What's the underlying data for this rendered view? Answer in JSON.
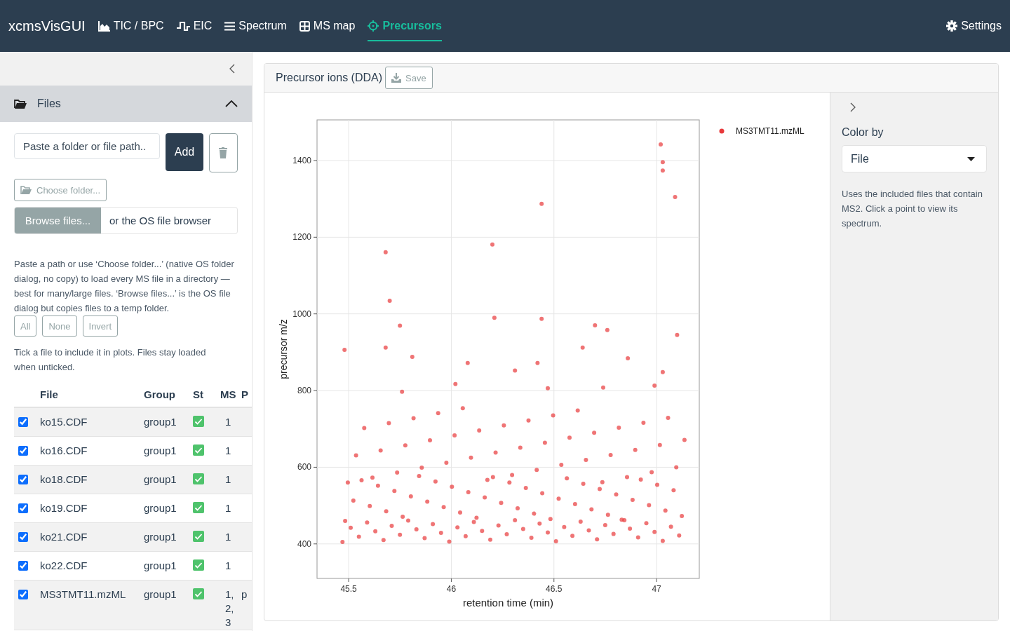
{
  "navbar": {
    "brand": "xcmsVisGUI",
    "tabs": [
      {
        "label": "TIC / BPC",
        "selected": false
      },
      {
        "label": "EIC",
        "selected": false
      },
      {
        "label": "Spectrum",
        "selected": false
      },
      {
        "label": "MS map",
        "selected": false
      },
      {
        "label": "Precursors",
        "selected": true
      }
    ],
    "settings": "Settings"
  },
  "sidebar": {
    "files_panel": {
      "title": "Files",
      "expanded": true,
      "path_field": {
        "placeholder": "Paste a folder or file path.."
      },
      "add_button": "Add",
      "choose_folder_button": "Choose folder...",
      "browse_button": "Browse files...",
      "browse_hint": "or the OS file browser",
      "help_text": "Paste a path or use ‘Choose folder...’ (native OS folder dialog, no copy) to load every MS file in a directory — best for many/large files. ‘Browse files...’ is the OS file dialog but copies files to a temp folder.",
      "select_buttons": [
        "All",
        "None",
        "Invert"
      ],
      "note": "Tick a file to include it in plots. Files stay loaded when unticked.",
      "table": {
        "columns": [
          "File",
          "Group",
          "St",
          "MS",
          "P"
        ],
        "rows": [
          {
            "checked": true,
            "file": "ko15.CDF",
            "group": "group1",
            "ok": true,
            "ms": "1"
          },
          {
            "checked": true,
            "file": "ko16.CDF",
            "group": "group1",
            "ok": true,
            "ms": "1"
          },
          {
            "checked": true,
            "file": "ko18.CDF",
            "group": "group1",
            "ok": true,
            "ms": "1"
          },
          {
            "checked": true,
            "file": "ko19.CDF",
            "group": "group1",
            "ok": true,
            "ms": "1"
          },
          {
            "checked": true,
            "file": "ko21.CDF",
            "group": "group1",
            "ok": true,
            "ms": "1"
          },
          {
            "checked": true,
            "file": "ko22.CDF",
            "group": "group1",
            "ok": true,
            "ms": "1"
          },
          {
            "checked": true,
            "file": "MS3TMT11.mzML",
            "group": "group1",
            "ok": true,
            "ms": "1, 2, 3",
            "column_5": "p"
          }
        ]
      }
    }
  },
  "main": {
    "card": {
      "title": "Precursor ions (DDA)",
      "save_button": {
        "label": "Save",
        "disabled": true
      },
      "chart_data": {
        "type": "scatter",
        "grid": true,
        "xlabel": "retention time (min)",
        "ylabel": "precursor m/z",
        "xlim": [
          45.346,
          47.208
        ],
        "ylim": [
          310,
          1506
        ],
        "xticks": [
          45.5,
          46,
          46.5,
          47
        ],
        "yticks": [
          400,
          600,
          800,
          1000,
          1200,
          1400
        ],
        "x": [
          45.47,
          45.483,
          45.496,
          45.51,
          45.523,
          45.536,
          45.55,
          45.563,
          45.576,
          45.59,
          45.603,
          45.616,
          45.63,
          45.643,
          45.656,
          45.67,
          45.683,
          45.696,
          45.71,
          45.723,
          45.736,
          45.75,
          45.763,
          45.776,
          45.79,
          45.803,
          45.816,
          45.83,
          45.843,
          45.856,
          45.87,
          45.883,
          45.896,
          45.91,
          45.923,
          45.936,
          45.95,
          45.963,
          45.976,
          45.99,
          46.003,
          46.016,
          46.03,
          46.043,
          46.056,
          46.07,
          46.083,
          46.096,
          46.11,
          46.123,
          46.136,
          46.15,
          46.163,
          46.176,
          46.19,
          46.203,
          46.216,
          46.23,
          46.243,
          46.256,
          46.27,
          46.283,
          46.296,
          46.31,
          46.323,
          46.336,
          46.35,
          46.363,
          46.376,
          46.39,
          46.403,
          46.416,
          46.43,
          46.443,
          46.456,
          46.47,
          46.483,
          46.496,
          46.51,
          46.523,
          46.536,
          46.55,
          46.563,
          46.576,
          46.59,
          46.603,
          46.616,
          46.63,
          46.643,
          46.656,
          46.67,
          46.683,
          46.696,
          46.71,
          46.723,
          46.736,
          46.75,
          46.763,
          46.776,
          46.79,
          46.803,
          46.816,
          46.83,
          46.843,
          46.856,
          46.87,
          46.883,
          46.896,
          46.91,
          46.923,
          46.936,
          46.95,
          46.963,
          46.976,
          46.99,
          47.003,
          47.016,
          47.03,
          47.043,
          47.056,
          47.07,
          47.083,
          47.096,
          47.11,
          47.123,
          47.136,
          47.02,
          47.03,
          47.03,
          47.09,
          46.44,
          45.68,
          46.2,
          45.7,
          46.21,
          46.44,
          45.75,
          46.7,
          46.76,
          45.48,
          45.68,
          47.1,
          45.81,
          46.08,
          46.31,
          46.42,
          46.64,
          46.86,
          47.03,
          46.02,
          46.47,
          46.74,
          45.76,
          46.99
        ],
        "series": [
          {
            "name": "MS3TMT11.mzML",
            "color": "#e8393b",
            "values": [
              405,
              460,
              560,
              442,
              513,
              631,
              419,
              566,
              702,
              456,
              499,
              573,
              433,
              552,
              644,
              410,
              485,
              715,
              447,
              538,
              586,
              424,
              471,
              657,
              461,
              524,
              728,
              438,
              577,
              599,
              415,
              510,
              670,
              452,
              563,
              741,
              429,
              496,
              612,
              406,
              549,
              683,
              443,
              482,
              754,
              420,
              535,
              625,
              457,
              468,
              696,
              434,
              521,
              567,
              411,
              574,
              638,
              448,
              507,
              709,
              425,
              560,
              580,
              462,
              493,
              651,
              439,
              546,
              722,
              416,
              479,
              593,
              453,
              532,
              664,
              430,
              465,
              735,
              407,
              518,
              606,
              444,
              571,
              677,
              421,
              504,
              748,
              458,
              557,
              619,
              435,
              490,
              690,
              412,
              543,
              561,
              449,
              476,
              632,
              426,
              529,
              703,
              463,
              462,
              574,
              440,
              515,
              645,
              417,
              568,
              716,
              454,
              501,
              587,
              431,
              554,
              658,
              408,
              487,
              729,
              445,
              540,
              600,
              422,
              473,
              671,
              1442,
              1396,
              1374,
              1305,
              1287,
              1161,
              1181,
              1034,
              990,
              987,
              969,
              970,
              958,
              906,
              912,
              945,
              888,
              872,
              852,
              872,
              912,
              884,
              848,
              817,
              806,
              808,
              797,
              813
            ]
          }
        ]
      }
    },
    "options": {
      "label": "Color by",
      "select": {
        "value": "File"
      },
      "help": "Uses the included files that contain MS2. Click a point to view its spectrum."
    }
  }
}
